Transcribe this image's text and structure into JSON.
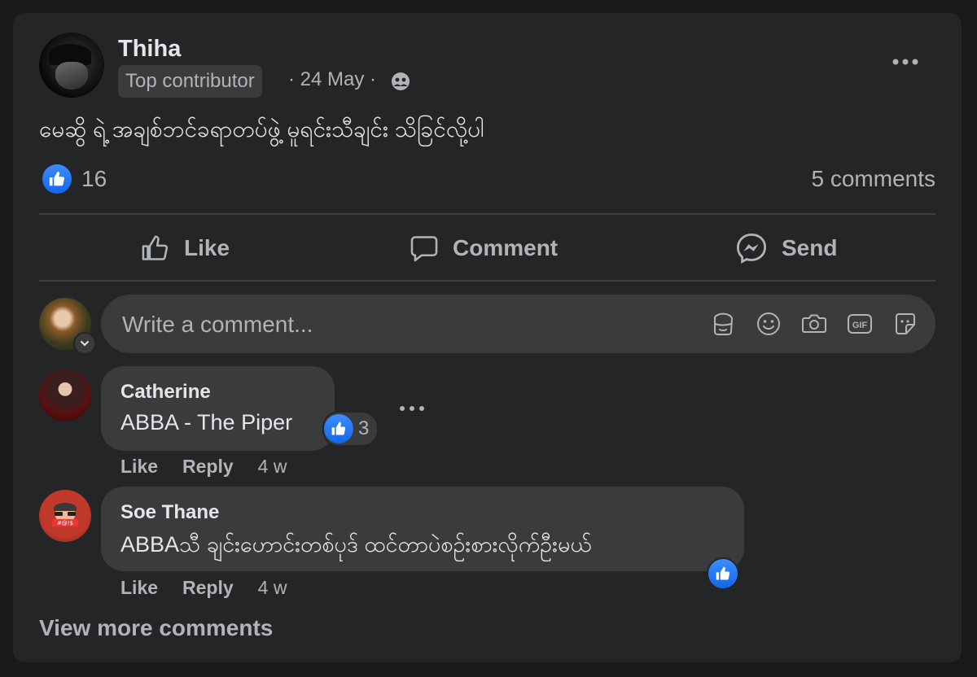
{
  "post": {
    "author": "Thiha",
    "badge": "Top contributor",
    "meta": "· 24 May ·",
    "text": "မေဆွိ ရဲ့ အချစ်ဘင်ခရာတပ်ဖွဲ့ မူရင်းသီချင်း သိခြင်လို့ပါ",
    "likes": "16",
    "comments_count": "5 comments"
  },
  "actions": {
    "like": "Like",
    "comment": "Comment",
    "send": "Send"
  },
  "composer": {
    "placeholder": "Write a comment..."
  },
  "comments": [
    {
      "name": "Catherine",
      "text": "ABBA - The Piper",
      "reactions": "3",
      "like": "Like",
      "reply": "Reply",
      "time": "4 w"
    },
    {
      "name": "Soe Thane",
      "text": "ABBAသီ ချင်းဟောင်းတစ်ပုဒ် ထင်တာပဲစဉ်းစားလိုက်ဦးမယ်",
      "like": "Like",
      "reply": "Reply",
      "time": "4 w"
    }
  ],
  "view_more": "View more comments",
  "colors": {
    "background": "#18191a",
    "card": "#242526",
    "bubble": "#3a3b3c",
    "accent_like": "#1877f2",
    "text_primary": "#e4e6eb",
    "text_secondary": "#b0b3b8"
  }
}
